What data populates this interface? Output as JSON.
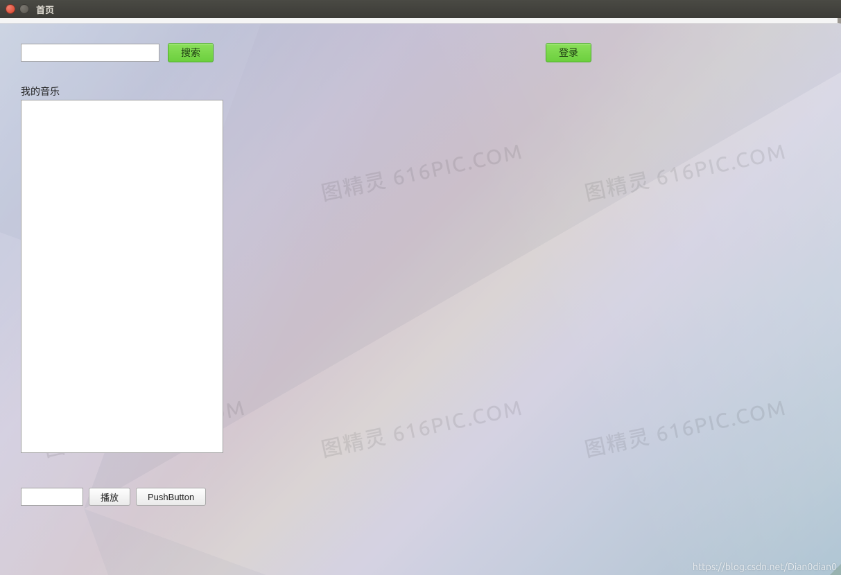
{
  "window": {
    "title": "首页"
  },
  "top": {
    "search_value": "",
    "search_button_label": "搜索",
    "login_button_label": "登录"
  },
  "sidebar": {
    "my_music_label": "我的音乐"
  },
  "bottom": {
    "input_value": "",
    "play_button_label": "播放",
    "push_button_label": "PushButton"
  },
  "watermark": {
    "text": "图精灵 616PIC.COM"
  },
  "footer": {
    "url_text": "https://blog.csdn.net/Dian0dian0"
  }
}
